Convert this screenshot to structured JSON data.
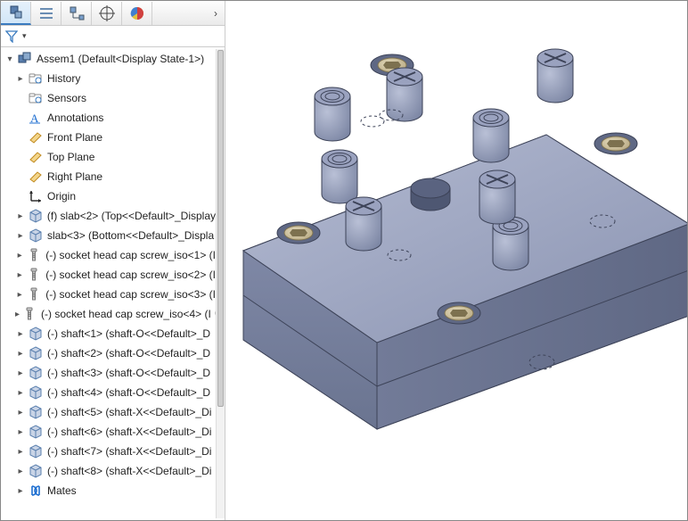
{
  "toolbar": {
    "tabs": [
      {
        "name": "feature-manager-tab",
        "active": true,
        "icon": "cube-tree"
      },
      {
        "name": "property-manager-tab",
        "active": false,
        "icon": "list"
      },
      {
        "name": "configuration-manager-tab",
        "active": false,
        "icon": "config-tree"
      },
      {
        "name": "dimxpert-manager-tab",
        "active": false,
        "icon": "target"
      },
      {
        "name": "display-manager-tab",
        "active": false,
        "icon": "appearance"
      }
    ],
    "overflow_glyph": "›"
  },
  "filter": {
    "dropdown_glyph": "▾"
  },
  "tree": {
    "root": {
      "label": "Assem1  (Default<Display State-1>)",
      "icon": "assembly"
    },
    "items": [
      {
        "twisty": "▸",
        "indent": 1,
        "icon": "folder-history",
        "label": "History"
      },
      {
        "twisty": "",
        "indent": 1,
        "icon": "folder-sensors",
        "label": "Sensors"
      },
      {
        "twisty": "",
        "indent": 1,
        "icon": "annotations",
        "label": "Annotations"
      },
      {
        "twisty": "",
        "indent": 1,
        "icon": "plane",
        "label": "Front Plane"
      },
      {
        "twisty": "",
        "indent": 1,
        "icon": "plane",
        "label": "Top Plane"
      },
      {
        "twisty": "",
        "indent": 1,
        "icon": "plane",
        "label": "Right Plane"
      },
      {
        "twisty": "",
        "indent": 1,
        "icon": "origin",
        "label": "Origin"
      },
      {
        "twisty": "▸",
        "indent": 1,
        "icon": "part",
        "label": "(f) slab<2>  (Top<<Default>_Display"
      },
      {
        "twisty": "▸",
        "indent": 1,
        "icon": "part",
        "label": "slab<3>  (Bottom<<Default>_Displa"
      },
      {
        "twisty": "▸",
        "indent": 1,
        "icon": "screw",
        "label": "(-) socket head cap screw_iso<1> (I"
      },
      {
        "twisty": "▸",
        "indent": 1,
        "icon": "screw",
        "label": "(-) socket head cap screw_iso<2> (I"
      },
      {
        "twisty": "▸",
        "indent": 1,
        "icon": "screw",
        "label": "(-) socket head cap screw_iso<3> (I"
      },
      {
        "twisty": "▸",
        "indent": 1,
        "icon": "screw",
        "label": "(-) socket head cap screw_iso<4> (I",
        "badge": "info"
      },
      {
        "twisty": "▸",
        "indent": 1,
        "icon": "part",
        "label": "(-) shaft<1>  (shaft-O<<Default>_D"
      },
      {
        "twisty": "▸",
        "indent": 1,
        "icon": "part",
        "label": "(-) shaft<2>  (shaft-O<<Default>_D"
      },
      {
        "twisty": "▸",
        "indent": 1,
        "icon": "part",
        "label": "(-) shaft<3>  (shaft-O<<Default>_D"
      },
      {
        "twisty": "▸",
        "indent": 1,
        "icon": "part",
        "label": "(-) shaft<4>  (shaft-O<<Default>_D"
      },
      {
        "twisty": "▸",
        "indent": 1,
        "icon": "part",
        "label": "(-) shaft<5>  (shaft-X<<Default>_Di"
      },
      {
        "twisty": "▸",
        "indent": 1,
        "icon": "part",
        "label": "(-) shaft<6>  (shaft-X<<Default>_Di"
      },
      {
        "twisty": "▸",
        "indent": 1,
        "icon": "part",
        "label": "(-) shaft<7>  (shaft-X<<Default>_Di"
      },
      {
        "twisty": "▸",
        "indent": 1,
        "icon": "part",
        "label": "(-) shaft<8>  (shaft-X<<Default>_Di"
      },
      {
        "twisty": "▸",
        "indent": 1,
        "icon": "mates",
        "label": "Mates"
      }
    ]
  },
  "colors": {
    "accent": "#3a7bbf",
    "plane_icon": "#e0a030",
    "origin_icon": "#222222",
    "part_icon": "#6a8db3",
    "screw_icon": "#888888",
    "mates_icon": "#1f6fd0",
    "assembly_icon": "#5a7fae",
    "model_body": "#8a93b1",
    "model_body_light": "#a3abc4",
    "model_body_dark": "#6a7490",
    "model_edge": "#3d4358",
    "brass": "#cbbd94",
    "brass_dark": "#7d714f"
  }
}
